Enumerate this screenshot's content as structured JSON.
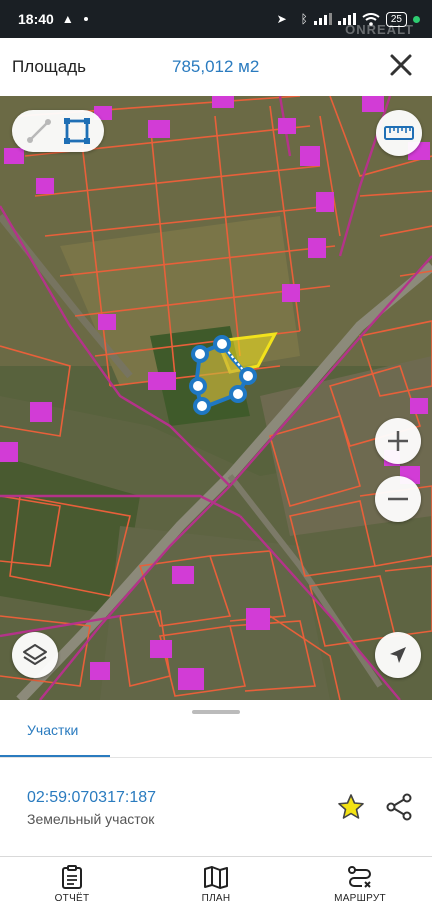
{
  "status_bar": {
    "time": "18:40",
    "battery": "25",
    "watermark": "ONREALT"
  },
  "header": {
    "label": "Площадь",
    "value": "785,012 м2"
  },
  "map": {
    "tools": [
      "line-tool-icon",
      "polygon-tool-icon"
    ],
    "colors": {
      "parcel_border": "#e8603a",
      "boundary_line": "#b4338a",
      "building": "#d23cd6",
      "selection": "#f2e21c",
      "measure_outline": "#1f78c4"
    }
  },
  "sheet": {
    "tab_label": "Участки",
    "parcel_id": "02:59:070317:187",
    "parcel_type": "Земельный участок"
  },
  "bottom_nav": {
    "items": [
      {
        "label": "ОТЧЁТ"
      },
      {
        "label": "ПЛАН"
      },
      {
        "label": "МАРШРУТ"
      }
    ]
  }
}
